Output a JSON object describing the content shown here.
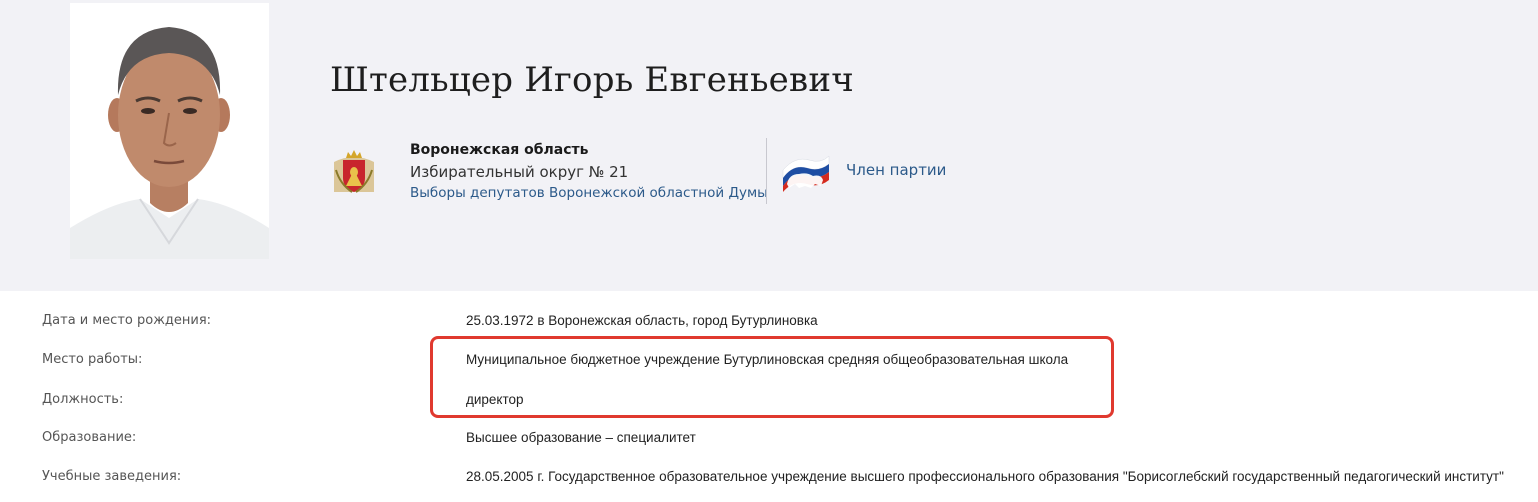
{
  "candidate": {
    "name": "Штельцер Игорь Евгеньевич",
    "region": "Воронежская область",
    "district": "Избирательный округ № 21",
    "election": "Выборы депутатов Воронежской областной Думы",
    "party_status": "Член партии"
  },
  "icons": {
    "coat_of_arms": "voronezh-coat-of-arms-icon",
    "party_logo": "united-russia-bear-logo-icon",
    "photo": "candidate-photo"
  },
  "colors": {
    "header_bg": "#f2f2f6",
    "link": "#2c5a8a",
    "highlight_border": "#e0392f"
  },
  "info": [
    {
      "label": "Дата и место рождения:",
      "value": "25.03.1972 в Воронежская область, город Бутурлиновка"
    },
    {
      "label": "Место работы:",
      "value": "Муниципальное бюджетное учреждение Бутурлиновская средняя общеобразовательная школа"
    },
    {
      "label": "Должность:",
      "value": "директор"
    },
    {
      "label": "Образование:",
      "value": "Высшее образование – специалитет"
    },
    {
      "label": "Учебные заведения:",
      "value": "28.05.2005 г. Государственное образовательное учреждение высшего профессионального образования \"Борисоглебский государственный педагогический институт\""
    }
  ]
}
